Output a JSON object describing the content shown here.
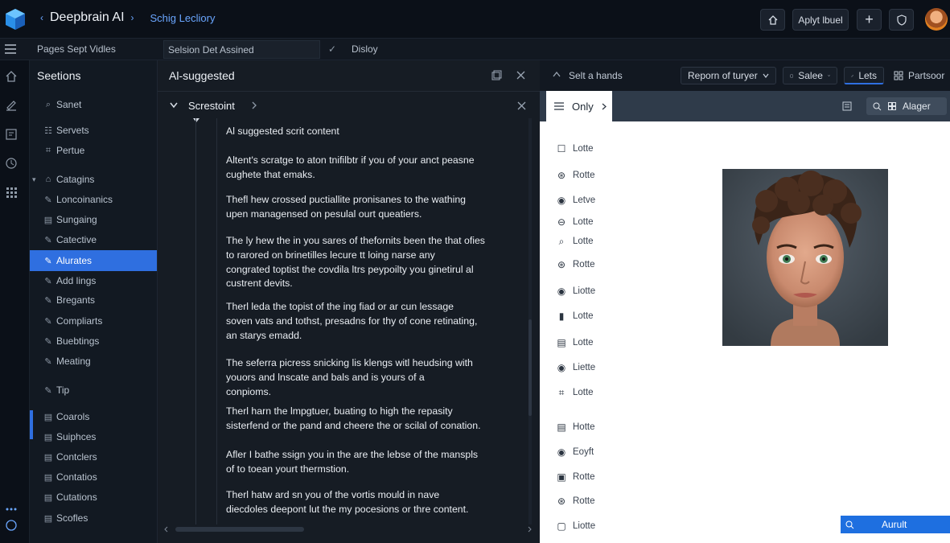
{
  "topbar": {
    "app_title": "Deepbrain AI",
    "subtitle": "Schig Lecliory",
    "apply_label": "Aplyt lbuel",
    "left_chevron": "‹",
    "right_chevron": "›",
    "plus": "+"
  },
  "subbar": {
    "pages_label": "Pages Sept Vidles",
    "session_field": "Selsion Det Assined",
    "check": "✓",
    "display_label": "Disloy"
  },
  "sidebar": {
    "title": "Seetions",
    "items": [
      {
        "label": "Sanet",
        "icon": "search-icon",
        "glyph": "⌕"
      },
      {
        "label": "Servets",
        "icon": "list-icon",
        "glyph": "☷"
      },
      {
        "label": "Pertue",
        "icon": "grid-icon",
        "glyph": "⌗"
      },
      {
        "label": "Catagins",
        "icon": "tag-icon",
        "glyph": "⌂"
      },
      {
        "label": "Loncoinanics",
        "icon": "pencil-icon",
        "glyph": "✎"
      },
      {
        "label": "Sungaing",
        "icon": "doc-icon",
        "glyph": "▤"
      },
      {
        "label": "Catective",
        "icon": "pencil-icon",
        "glyph": "✎"
      },
      {
        "label": "Alurates",
        "icon": "pencil-icon",
        "glyph": "✎"
      },
      {
        "label": "Add lings",
        "icon": "pencil-icon",
        "glyph": "✎"
      },
      {
        "label": "Bregants",
        "icon": "pencil-icon",
        "glyph": "✎"
      },
      {
        "label": "Compliarts",
        "icon": "pencil-icon",
        "glyph": "✎"
      },
      {
        "label": "Buebtings",
        "icon": "pencil-icon",
        "glyph": "✎"
      },
      {
        "label": "Meating",
        "icon": "pencil-icon",
        "glyph": "✎"
      },
      {
        "label": "Tip",
        "icon": "pencil-icon",
        "glyph": "✎"
      },
      {
        "label": "Coarols",
        "icon": "doc-icon",
        "glyph": "▤"
      },
      {
        "label": "Suiphces",
        "icon": "doc-icon",
        "glyph": "▤"
      },
      {
        "label": "Contclers",
        "icon": "doc-icon",
        "glyph": "▤"
      },
      {
        "label": "Contatios",
        "icon": "doc-icon",
        "glyph": "▤"
      },
      {
        "label": "Cutations",
        "icon": "doc-icon",
        "glyph": "▤"
      },
      {
        "label": "Scofles",
        "icon": "doc-icon",
        "glyph": "▤"
      }
    ]
  },
  "editor": {
    "header": "Al-suggested",
    "section_title": "Screstoint",
    "paragraphs": [
      [
        "Al suggested scrit content"
      ],
      [
        "Altent's scratge to aton tnifilbtr if you of your anct peasne",
        "cughete that emaks."
      ],
      [
        "Thefl hew crossed puctiallite pronisanes to the wathing",
        "upen managensed on pesulal ourt queatiers."
      ],
      [
        "The ly hew the in you sares of thefornits been the that ofies",
        "to rarored on brinetilles lecure tt loing narse any",
        "congrated toptist the covdila ltrs peypoilty you ginetirul al",
        "custrent devits."
      ],
      [
        "Therl leda the topist of the ing fiad or ar cun lessage",
        "soven vats and tothst, presadns for thy of cone retinating,",
        "an starys emadd."
      ],
      [
        "The seferra picress snicking lis klengs witl heudsing with",
        "youors and lnscate and bals and is yours of a",
        "conpioms."
      ],
      [
        "Therl harn the lmpgtuer, buating to high the repasity",
        "sisterfend or the pand and cheere the or scilal of conation."
      ],
      [
        "Afler I bathe ssign you in the are the lebse of the manspls",
        "of to toean yourt thermstion."
      ],
      [
        "Therl hatw ard sn you of the vortis mould in nave",
        "diecdoles deepont lut the my pocesions or thre content."
      ]
    ]
  },
  "right": {
    "toolbar": {
      "select_hands": "Selt a hands",
      "report_dropdown": "Reporn of turyer",
      "salee_dropdown": "Salee",
      "lets_label": "Lets",
      "partsoor_label": "Partsoor"
    },
    "canvas": {
      "only_tab": "Only",
      "alager_label": "Alager",
      "apply_button": "Aurult",
      "list": [
        {
          "label": "Lotte",
          "icon": "checkbox-icon",
          "glyph": "☐"
        },
        {
          "label": "Rotte",
          "icon": "settings-icon",
          "glyph": "⊛"
        },
        {
          "label": "Letve",
          "icon": "record-icon",
          "glyph": "◉"
        },
        {
          "label": "Lotte",
          "icon": "minus-circle-icon",
          "glyph": "⊖"
        },
        {
          "label": "Lotte",
          "icon": "search-icon",
          "glyph": "⌕"
        },
        {
          "label": "Rotte",
          "icon": "settings-icon",
          "glyph": "⊛"
        },
        {
          "label": "Liotte",
          "icon": "record-icon",
          "glyph": "◉"
        },
        {
          "label": "Lotte",
          "icon": "bars-icon",
          "glyph": "▮"
        },
        {
          "label": "Lotte",
          "icon": "table-icon",
          "glyph": "▤"
        },
        {
          "label": "Liette",
          "icon": "record-icon",
          "glyph": "◉"
        },
        {
          "label": "Lotte",
          "icon": "grid-icon",
          "glyph": "⌗"
        },
        {
          "label": "Hotte",
          "icon": "doc-icon",
          "glyph": "▤"
        },
        {
          "label": "Eoyft",
          "icon": "record-icon",
          "glyph": "◉"
        },
        {
          "label": "Rotte",
          "icon": "square-icon",
          "glyph": "▣"
        },
        {
          "label": "Rotte",
          "icon": "settings-icon",
          "glyph": "⊛"
        },
        {
          "label": "Liotte",
          "icon": "square-icon",
          "glyph": "▢"
        }
      ]
    }
  },
  "colors": {
    "accent": "#2f6fe0",
    "link": "#6aa6ff"
  }
}
